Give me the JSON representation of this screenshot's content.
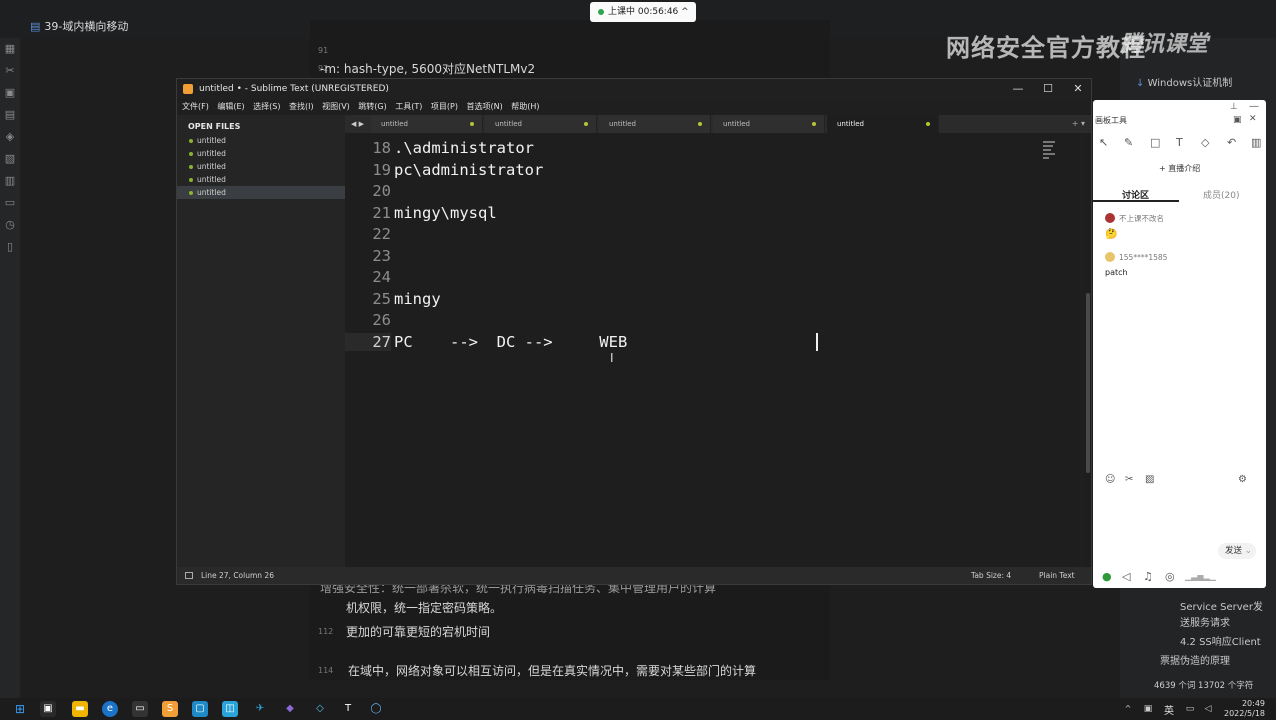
{
  "background_app": {
    "doc_title": "39-域内横向移动",
    "watermark": "网络安全官方教程",
    "watermark_brand": "腾讯课堂",
    "lines": [
      {
        "num": "91",
        "text": ""
      },
      {
        "num": "92",
        "text": "-m: hash-type, 5600对应NetNTLMv2"
      },
      {
        "num": "",
        "text": "增强安全性：统一部署杀软，统一执行病毒扫描任务、集中管理用户的计算"
      },
      {
        "num": "",
        "text": "机权限，统一指定密码策略。"
      },
      {
        "num": "112",
        "text": "更加的可靠更短的宕机时间"
      },
      {
        "num": "114",
        "text": "在域中，网络对象可以相互访问，但是在真实情况中，需要对某些部门的计算"
      }
    ],
    "outline": [
      "Windows认证机制",
      "Service Server发",
      "送服务请求",
      "4.2 SS响应Client",
      "票据伪造的原理"
    ],
    "word_count": "4639 个词",
    "char_count": "13702 个字符"
  },
  "live_badge": {
    "text": "上课中 00:56:46",
    "chevron": "^"
  },
  "sublime": {
    "title": "untitled • - Sublime Text (UNREGISTERED)",
    "menu": [
      "文件(F)",
      "编辑(E)",
      "选择(S)",
      "查找(I)",
      "视图(V)",
      "跳转(G)",
      "工具(T)",
      "项目(P)",
      "首选项(N)",
      "帮助(H)"
    ],
    "sidebar_header": "OPEN FILES",
    "open_files": [
      "untitled",
      "untitled",
      "untitled",
      "untitled",
      "untitled"
    ],
    "active_file_index": 4,
    "tabs": [
      "untitled",
      "untitled",
      "untitled",
      "untitled",
      "untitled"
    ],
    "active_tab_index": 4,
    "lines": [
      {
        "num": "18",
        "text": ".\\administrator"
      },
      {
        "num": "19",
        "text": "pc\\administrator"
      },
      {
        "num": "20",
        "text": ""
      },
      {
        "num": "21",
        "text": "mingy\\mysql"
      },
      {
        "num": "22",
        "text": ""
      },
      {
        "num": "23",
        "text": ""
      },
      {
        "num": "24",
        "text": ""
      },
      {
        "num": "25",
        "text": "mingy"
      },
      {
        "num": "26",
        "text": ""
      },
      {
        "num": "27",
        "text": "PC    -->  DC -->     WEB"
      }
    ],
    "current_line": "27",
    "status_left": "Line 27, Column 26",
    "tab_size": "Tab Size: 4",
    "syntax": "Plain Text"
  },
  "whiteboard": {
    "title": "画板工具",
    "live_intro": "+ 直播介绍",
    "tab_discuss": "讨论区",
    "tab_members": "成员(20)",
    "messages": [
      {
        "name": "不上课不改名",
        "text": "🤔"
      },
      {
        "name": "155****1585",
        "text": "patch"
      }
    ],
    "send_label": "发送"
  },
  "taskbar": {
    "lang": "英",
    "time": "20:49",
    "date": "2022/5/18"
  }
}
